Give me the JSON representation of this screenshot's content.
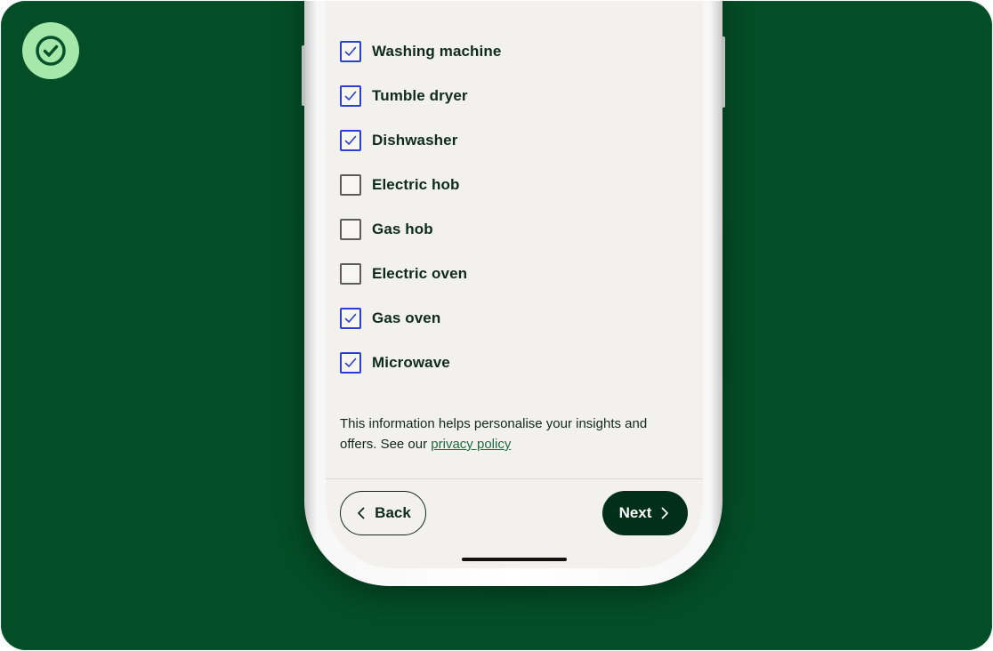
{
  "badge": {
    "icon": "check-circle-icon",
    "color": "#a6e8a9"
  },
  "appliances": [
    {
      "label": "Washing machine",
      "checked": true
    },
    {
      "label": "Tumble dryer",
      "checked": true
    },
    {
      "label": "Dishwasher",
      "checked": true
    },
    {
      "label": "Electric hob",
      "checked": false
    },
    {
      "label": "Gas hob",
      "checked": false
    },
    {
      "label": "Electric oven",
      "checked": false
    },
    {
      "label": "Gas oven",
      "checked": true
    },
    {
      "label": "Microwave",
      "checked": true
    }
  ],
  "info": {
    "text": "This information helps personalise your insights and offers. See our ",
    "link_label": "privacy policy"
  },
  "nav": {
    "back_label": "Back",
    "next_label": "Next"
  },
  "colors": {
    "background": "#034d27",
    "checkbox_checked": "#2b3fd1",
    "next_button": "#022f1a"
  }
}
